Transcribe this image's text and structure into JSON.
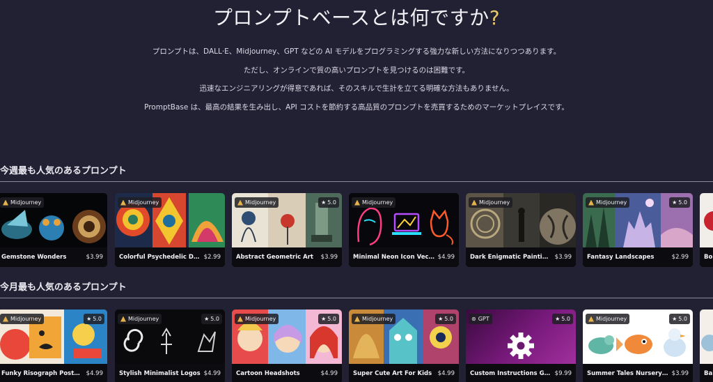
{
  "hero": {
    "title": "プロンプトベースとは何ですか",
    "title_mark": "?",
    "lines": [
      "プロンプトは、DALL·E、Midjourney、GPT などの AI モデルをプログラミングする強力な新しい方法になりつつあります。",
      "ただし、オンラインで質の高いプロンプトを見つけるのは困難です。",
      "迅速なエンジニアリングが得意であれば、そのスキルで生計を立てる明確な方法もありません。",
      "PromptBase は、最高の結果を生み出し、API コストを節約する高品質のプロンプトを売買するためのマーケットプレイスです。"
    ]
  },
  "weekly": {
    "title": "今週最も人気のあるプロンプト",
    "cards": [
      {
        "name": "Gemstone Wonders",
        "price": "$3.99",
        "model": "Midjourney",
        "rating": ""
      },
      {
        "name": "Colorful Psychedelic Designs",
        "price": "$2.99",
        "model": "Midjourney",
        "rating": ""
      },
      {
        "name": "Abstract Geometric Art",
        "price": "$3.99",
        "model": "Midjourney",
        "rating": "5.0"
      },
      {
        "name": "Minimal Neon Icon Vectors",
        "price": "$4.99",
        "model": "Midjourney",
        "rating": ""
      },
      {
        "name": "Dark Enigmatic Paintings",
        "price": "$3.99",
        "model": "Midjourney",
        "rating": ""
      },
      {
        "name": "Fantasy Landscapes",
        "price": "$2.99",
        "model": "Midjourney",
        "rating": "5.0"
      },
      {
        "name": "Bold",
        "price": "",
        "model": "",
        "rating": ""
      }
    ]
  },
  "monthly": {
    "title": "今月最も人気のあるプロンプト",
    "cards": [
      {
        "name": "Funky Risograph Posters",
        "price": "$4.99",
        "model": "Midjourney",
        "rating": "5.0"
      },
      {
        "name": "Stylish Minimalist Logos",
        "price": "$4.99",
        "model": "Midjourney",
        "rating": "5.0"
      },
      {
        "name": "Cartoon Headshots",
        "price": "$4.99",
        "model": "Midjourney",
        "rating": "5.0"
      },
      {
        "name": "Super Cute Art For Kids",
        "price": "$4.99",
        "model": "Midjourney",
        "rating": "5.0"
      },
      {
        "name": "Custom Instructions Godmode",
        "price": "$9.99",
        "model": "GPT",
        "rating": "5.0"
      },
      {
        "name": "Summer Tales Nursery Art",
        "price": "$3.99",
        "model": "Midjourney",
        "rating": "5.0"
      },
      {
        "name": "Bab",
        "price": "",
        "model": "",
        "rating": ""
      }
    ]
  },
  "icons": {
    "star": "star-icon",
    "midjourney": "midjourney-sail-icon",
    "gpt": "openai-icon"
  }
}
